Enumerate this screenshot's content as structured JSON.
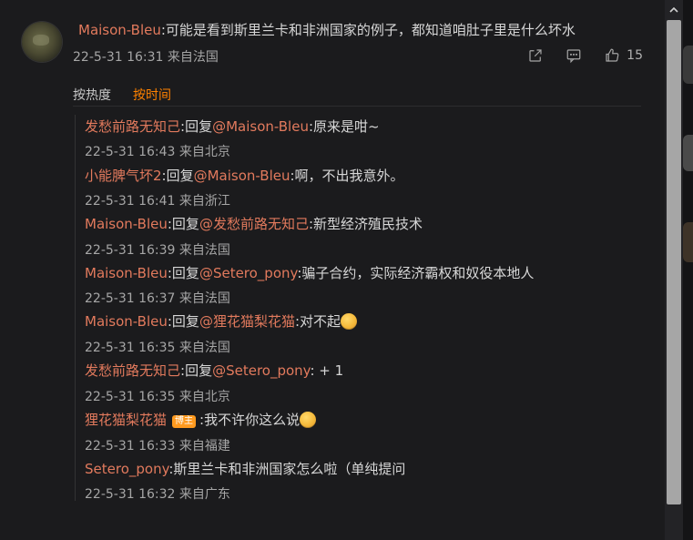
{
  "comment": {
    "user": "Maison-Bleu",
    "text": ":可能是看到斯里兰卡和非洲国家的例子，都知道咱肚子里是什么坏水",
    "time": "22-5-31 16:31 来自法国",
    "like_count": "15"
  },
  "sort_tabs": [
    {
      "label": "按热度",
      "active": false
    },
    {
      "label": "按时间",
      "active": true
    }
  ],
  "replies": [
    {
      "user": "发愁前路无知己",
      "reply_word": ":回复",
      "mention": "@Maison-Bleu",
      "text": ":原来是咁~",
      "time": "22-5-31 16:43 来自北京"
    },
    {
      "user": "小能脾气坏2",
      "reply_word": ":回复",
      "mention": "@Maison-Bleu",
      "text": ":啊，不出我意外。",
      "time": "22-5-31 16:41 来自浙江"
    },
    {
      "user": "Maison-Bleu",
      "reply_word": ":回复",
      "mention": "@发愁前路无知己",
      "text": ":新型经济殖民技术",
      "time": "22-5-31 16:39 来自法国"
    },
    {
      "user": "Maison-Bleu",
      "reply_word": ":回复",
      "mention": "@Setero_pony",
      "text": ":骗子合约，实际经济霸权和奴役本地人",
      "time": "22-5-31 16:37 来自法国"
    },
    {
      "user": "Maison-Bleu",
      "reply_word": ":回复",
      "mention": "@狸花猫梨花猫",
      "text": ":对不起",
      "emoji": "crying-laughing-emoji",
      "time": "22-5-31 16:35 来自法国"
    },
    {
      "user": "发愁前路无知己",
      "reply_word": ":回复",
      "mention": "@Setero_pony",
      "text": ": + 1",
      "time": "22-5-31 16:35 来自北京"
    },
    {
      "user": "狸花猫梨花猫",
      "badge": "博主",
      "text": ":我不许你这么说",
      "emoji": "crying-emoji",
      "time": "22-5-31 16:33 来自福建"
    },
    {
      "user": "Setero_pony",
      "text": ":斯里兰卡和非洲国家怎么啦（单纯提问",
      "time": "22-5-31 16:32 来自广东"
    }
  ],
  "icons": {
    "share": "share-icon",
    "comment": "comment-icon",
    "like": "thumbs-up-icon",
    "scroll_up": "chevron-up-icon"
  },
  "colors": {
    "accent": "#ff8200",
    "username": "#e27a5d"
  }
}
